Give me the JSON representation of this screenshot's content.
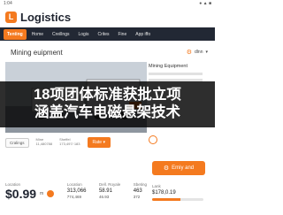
{
  "status": {
    "time": "1:04",
    "right": "● ▲ ■"
  },
  "app": {
    "logo_letter": "L",
    "name": "Logistics"
  },
  "nav": {
    "items": [
      {
        "label": "Tenting",
        "active": true
      },
      {
        "label": "Home"
      },
      {
        "label": "Creillngs"
      },
      {
        "label": "Logis"
      },
      {
        "label": "Crites"
      },
      {
        "label": "Fine"
      },
      {
        "label": "App iffo"
      }
    ]
  },
  "page": {
    "section_title": "Mining euipment",
    "language": "dlnn"
  },
  "side": {
    "title": "Mining Equipment"
  },
  "overlay": {
    "line1": "18项团体标准获批立项",
    "line2": "涵盖汽车电磁悬架技术"
  },
  "filter": {
    "chip1": "Cralings",
    "col1_label": "Mine",
    "col1_val": "11,480788",
    "col2_label": "Sheffel",
    "col2_val": "173,497/ 183",
    "chip_orange": "Rate ▾"
  },
  "cart": {
    "label": "Emiy and"
  },
  "stats": {
    "price_label": "Location",
    "price": "$0.99",
    "price_unit": "m",
    "col2_label": "Location",
    "col2_val": "313,066",
    "col2_sub": "774,469",
    "col3_label": "Dell. Royale",
    "col3_val": "58.91",
    "col3_sub": "46.93",
    "col4_label": "Sbeting",
    "col4_val": "463",
    "col4_sub": "372"
  },
  "rate": {
    "label": "Lank",
    "value": "$178,0.19",
    "fill_fraction": 0.55
  },
  "colors": {
    "accent": "#f47a1f",
    "nav_bg": "#222834",
    "overlay": "#000000"
  }
}
